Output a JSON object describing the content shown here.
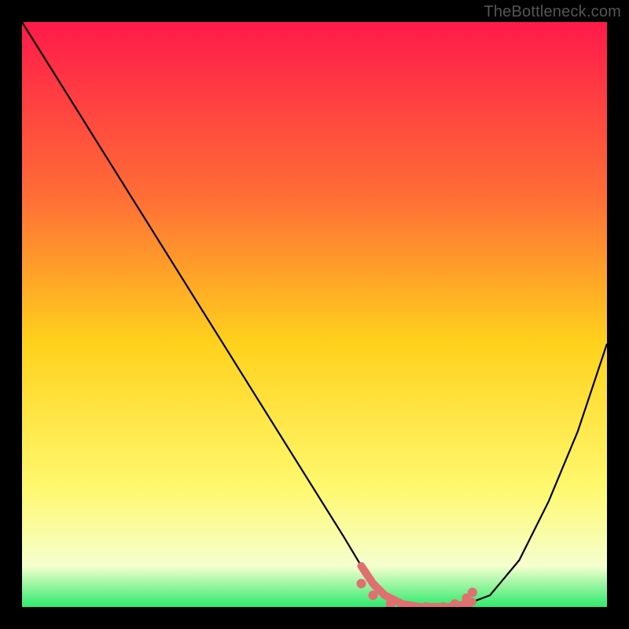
{
  "watermark": "TheBottleneck.com",
  "colors": {
    "bg": "#000000",
    "grad_top": "#ff1a4a",
    "grad_mid1": "#ff6e36",
    "grad_mid2": "#ffd21c",
    "grad_mid3": "#fff970",
    "grad_low": "#f6ffcf",
    "grad_bottom": "#2eea6c",
    "curve": "#000000",
    "marker": "#e07070"
  },
  "chart_data": {
    "type": "line",
    "title": "",
    "xlabel": "",
    "ylabel": "",
    "xlim": [
      0,
      100
    ],
    "ylim": [
      0,
      100
    ],
    "series": [
      {
        "name": "bottleneck-curve",
        "x": [
          0,
          5,
          10,
          15,
          20,
          25,
          30,
          35,
          40,
          45,
          50,
          55,
          58,
          60,
          62,
          65,
          68,
          70,
          73,
          76,
          80,
          85,
          90,
          95,
          100
        ],
        "y": [
          100,
          92,
          84,
          76,
          68,
          60,
          52,
          44,
          36,
          28,
          20,
          12,
          7,
          4,
          2,
          0.5,
          0,
          0,
          0,
          0.5,
          2,
          8,
          18,
          30,
          45
        ]
      }
    ],
    "optimal_zone": {
      "start_x": 58,
      "end_x": 77,
      "y": 0
    },
    "markers": [
      {
        "x": 58,
        "y": 4
      },
      {
        "x": 60,
        "y": 2
      },
      {
        "x": 63,
        "y": 0.5
      },
      {
        "x": 66,
        "y": 0
      },
      {
        "x": 69,
        "y": 0
      },
      {
        "x": 72,
        "y": 0
      },
      {
        "x": 74,
        "y": 0.5
      },
      {
        "x": 76,
        "y": 1.5
      },
      {
        "x": 77,
        "y": 2.5
      }
    ]
  }
}
